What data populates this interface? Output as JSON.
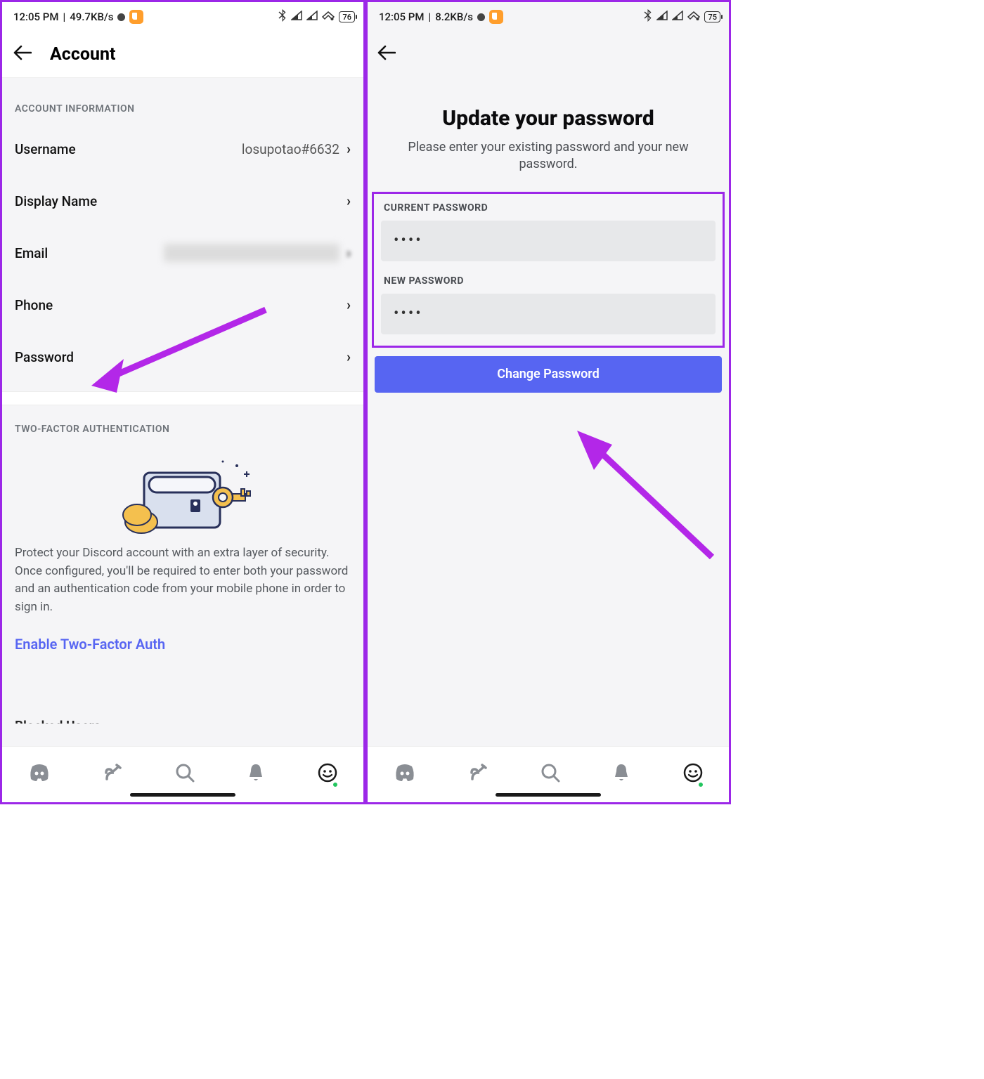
{
  "left": {
    "status": {
      "time": "12:05 PM",
      "speed": "49.7KB/s",
      "battery": "76"
    },
    "header": {
      "title": "Account"
    },
    "section1_label": "ACCOUNT INFORMATION",
    "rows": {
      "username": {
        "label": "Username",
        "value": "losupotao#6632"
      },
      "display": {
        "label": "Display Name"
      },
      "email": {
        "label": "Email"
      },
      "phone": {
        "label": "Phone"
      },
      "password": {
        "label": "Password"
      }
    },
    "section2_label": "TWO-FACTOR AUTHENTICATION",
    "twofa_desc": "Protect your Discord account with an extra layer of security. Once configured, you'll be required to enter both your password and an authentication code from your mobile phone in order to sign in.",
    "twofa_link": "Enable Two-Factor Auth",
    "blocked_label": "Blocked Users"
  },
  "right": {
    "status": {
      "time": "12:05 PM",
      "speed": "8.2KB/s",
      "battery": "75"
    },
    "title": "Update your password",
    "subtitle": "Please enter your existing password and your new password.",
    "current_label": "CURRENT PASSWORD",
    "current_value": "••••",
    "new_label": "NEW PASSWORD",
    "new_value": "••••",
    "button": "Change Password"
  }
}
